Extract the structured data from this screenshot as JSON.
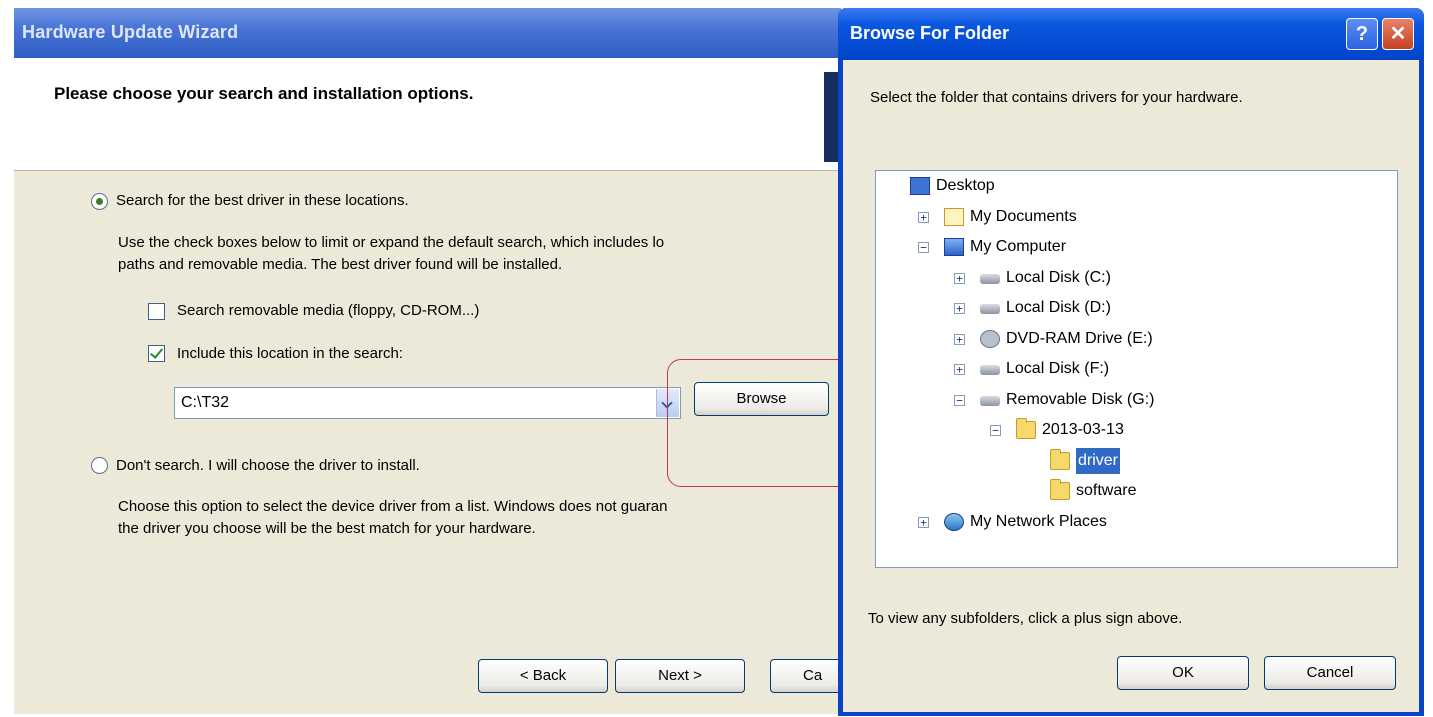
{
  "wizard": {
    "title": "Hardware Update Wizard",
    "header_title": "Please choose your search and installation options.",
    "option_search_label": "Search for the best driver in these locations.",
    "option_search_desc_line1": "Use the check boxes below to limit or expand the default search, which includes lo",
    "option_search_desc_line2": "paths and removable media. The best driver found will be installed.",
    "checkbox_removable_label": "Search removable media (floppy, CD-ROM...)",
    "checkbox_removable_checked": false,
    "checkbox_location_label": "Include this location in the search:",
    "checkbox_location_checked": true,
    "location_value": "C:\\T32",
    "browse_label": "Browse",
    "option_dont_search_label": "Don't search. I will choose the driver to install.",
    "option_dont_search_desc_line1": "Choose this option to select the device driver from a list.  Windows does not guaran",
    "option_dont_search_desc_line2": "the driver you choose will be the best match for your hardware.",
    "back_label": "< Back",
    "next_label": "Next >",
    "cancel_label": "Ca"
  },
  "dialog": {
    "title": "Browse For Folder",
    "help_glyph": "?",
    "close_glyph": "✕",
    "instruction": "Select the folder that contains drivers for your hardware.",
    "tree": [
      {
        "label": "Desktop",
        "icon": "desktop-icon"
      },
      {
        "label": "My Documents",
        "icon": "documents-folder-icon",
        "expander": "+"
      },
      {
        "label": "My Computer",
        "icon": "computer-icon",
        "expander": "−"
      },
      {
        "label": "Local Disk (C:)",
        "icon": "disk-drive-icon",
        "expander": "+"
      },
      {
        "label": "Local Disk (D:)",
        "icon": "disk-drive-icon",
        "expander": "+"
      },
      {
        "label": "DVD-RAM Drive (E:)",
        "icon": "dvd-drive-icon",
        "expander": "+"
      },
      {
        "label": "Local Disk (F:)",
        "icon": "disk-drive-icon",
        "expander": "+"
      },
      {
        "label": "Removable Disk (G:)",
        "icon": "removable-disk-icon",
        "expander": "−"
      },
      {
        "label": "2013-03-13",
        "icon": "folder-icon",
        "expander": "−"
      },
      {
        "label": "driver",
        "icon": "folder-icon",
        "selected": true
      },
      {
        "label": "software",
        "icon": "folder-icon"
      },
      {
        "label": "My Network Places",
        "icon": "network-places-icon",
        "expander": "+"
      }
    ],
    "hint": "To view any subfolders, click a plus sign above.",
    "ok_label": "OK",
    "cancel_label": "Cancel"
  },
  "colors": {
    "wizard_title_bar": "#4a74d6",
    "dialog_title_bar": "#0043c8",
    "selection": "#316ac5",
    "annotation_outline": "#c0394a",
    "window_face": "#ece9d8"
  }
}
